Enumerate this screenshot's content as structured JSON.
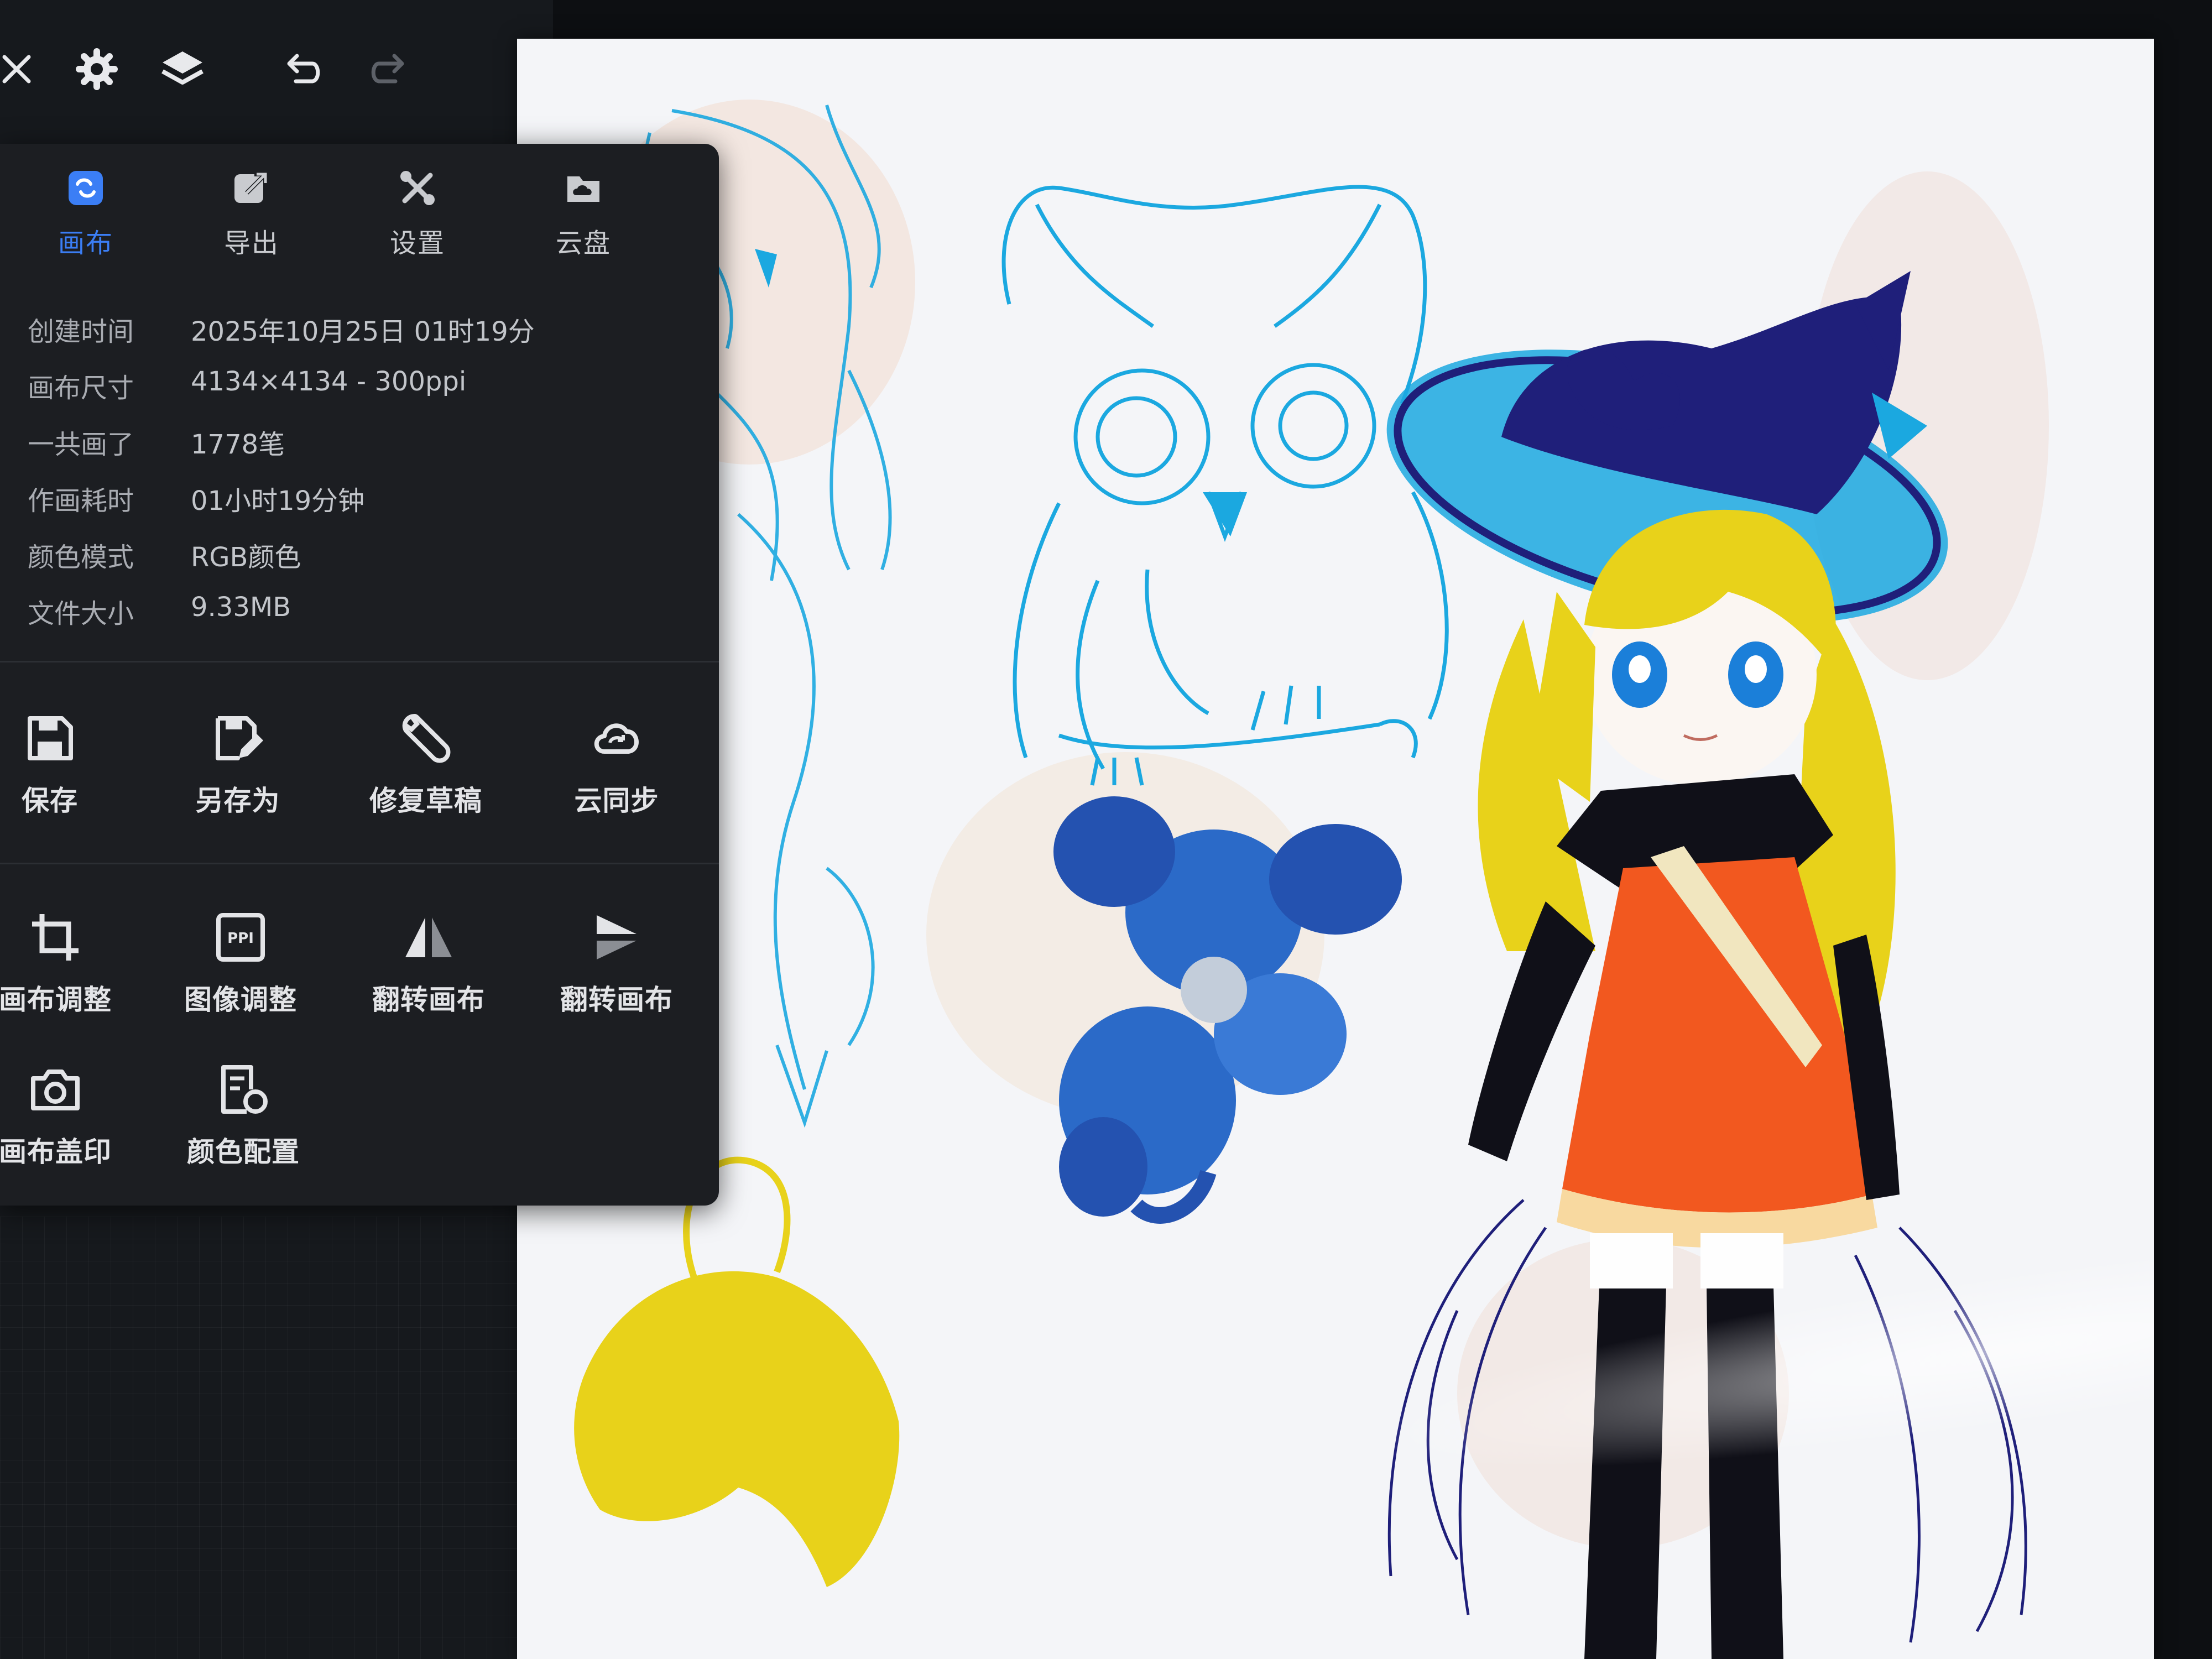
{
  "toolbar": {
    "close": "close-icon",
    "settings": "gear-icon",
    "layers": "layers-icon",
    "undo": "undo-icon",
    "redo": "redo-icon"
  },
  "tabs": [
    {
      "label": "画布",
      "icon": "canvas-icon",
      "active": true
    },
    {
      "label": "导出",
      "icon": "export-icon",
      "active": false
    },
    {
      "label": "设置",
      "icon": "tools-icon",
      "active": false
    },
    {
      "label": "云盘",
      "icon": "cloud-drive-icon",
      "active": false
    }
  ],
  "info": [
    {
      "key": "创建时间",
      "value": "2025年10月25日 01时19分"
    },
    {
      "key": "画布尺寸",
      "value": "4134×4134 - 300ppi"
    },
    {
      "key": "一共画了",
      "value": "1778笔"
    },
    {
      "key": "作画耗时",
      "value": "01小时19分钟"
    },
    {
      "key": "颜色模式",
      "value": "RGB颜色"
    },
    {
      "key": "文件大小",
      "value": "9.33MB"
    }
  ],
  "actions_row1": [
    {
      "label": "保存",
      "icon": "save-icon"
    },
    {
      "label": "另存为",
      "icon": "save-as-icon"
    },
    {
      "label": "修复草稿",
      "icon": "wrench-icon"
    },
    {
      "label": "云同步",
      "icon": "cloud-sync-icon"
    }
  ],
  "actions_row2": [
    {
      "label": "画布调整",
      "icon": "crop-icon"
    },
    {
      "label": "图像调整",
      "icon": "ppi-icon"
    },
    {
      "label": "翻转画布",
      "icon": "flip-horizontal-icon"
    },
    {
      "label": "翻转画布",
      "icon": "flip-vertical-icon"
    }
  ],
  "actions_row3": [
    {
      "label": "画布盖印",
      "icon": "camera-icon"
    },
    {
      "label": "颜色配置",
      "icon": "color-config-icon"
    }
  ],
  "colors": {
    "accent": "#3b7ef5",
    "panel": "#1c1e22",
    "canvas": "#f4f5f8",
    "sketch_cyan": "#1ba8e0",
    "navy": "#1f1f7a",
    "yellow": "#e8d21a",
    "orange_dress": "#f2581f"
  }
}
